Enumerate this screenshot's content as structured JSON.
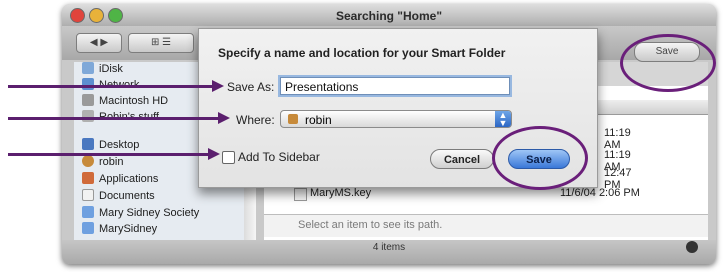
{
  "window": {
    "title": "Searching \"Home\"",
    "toolbar_save_label": "Save"
  },
  "sidebar": {
    "items": [
      {
        "label": "iDisk",
        "icon": "idisk-icon"
      },
      {
        "label": "Network",
        "icon": "network-icon"
      },
      {
        "label": "Macintosh HD",
        "icon": "harddisk-icon"
      },
      {
        "label": "Robin's stuff",
        "icon": "disk-icon"
      },
      {
        "label": "Desktop",
        "icon": "desktop-icon"
      },
      {
        "label": "robin",
        "icon": "home-icon"
      },
      {
        "label": "Applications",
        "icon": "applications-icon"
      },
      {
        "label": "Documents",
        "icon": "documents-icon"
      },
      {
        "label": "Mary Sidney Society",
        "icon": "folder-icon"
      },
      {
        "label": "MarySidney",
        "icon": "folder-icon"
      }
    ]
  },
  "results": {
    "rows": [
      {
        "name": "",
        "date": "11:19 AM"
      },
      {
        "name": "",
        "date": "11:19 AM"
      },
      {
        "name": "",
        "date": "12:47 PM"
      },
      {
        "name": "MaryMS.key",
        "date": "11/6/04 2:06 PM"
      }
    ],
    "path_placeholder": "Select an item to see its path.",
    "status": "4 items"
  },
  "dialog": {
    "heading": "Specify a name and location for your Smart Folder",
    "save_as_label": "Save As:",
    "save_as_value": "Presentations",
    "where_label": "Where:",
    "where_value": "robin",
    "add_to_sidebar_label": "Add To Sidebar",
    "add_to_sidebar_checked": false,
    "cancel_label": "Cancel",
    "save_label": "Save"
  },
  "colors": {
    "annotation": "#5b1f6e",
    "default_button": "#3a78d8"
  }
}
